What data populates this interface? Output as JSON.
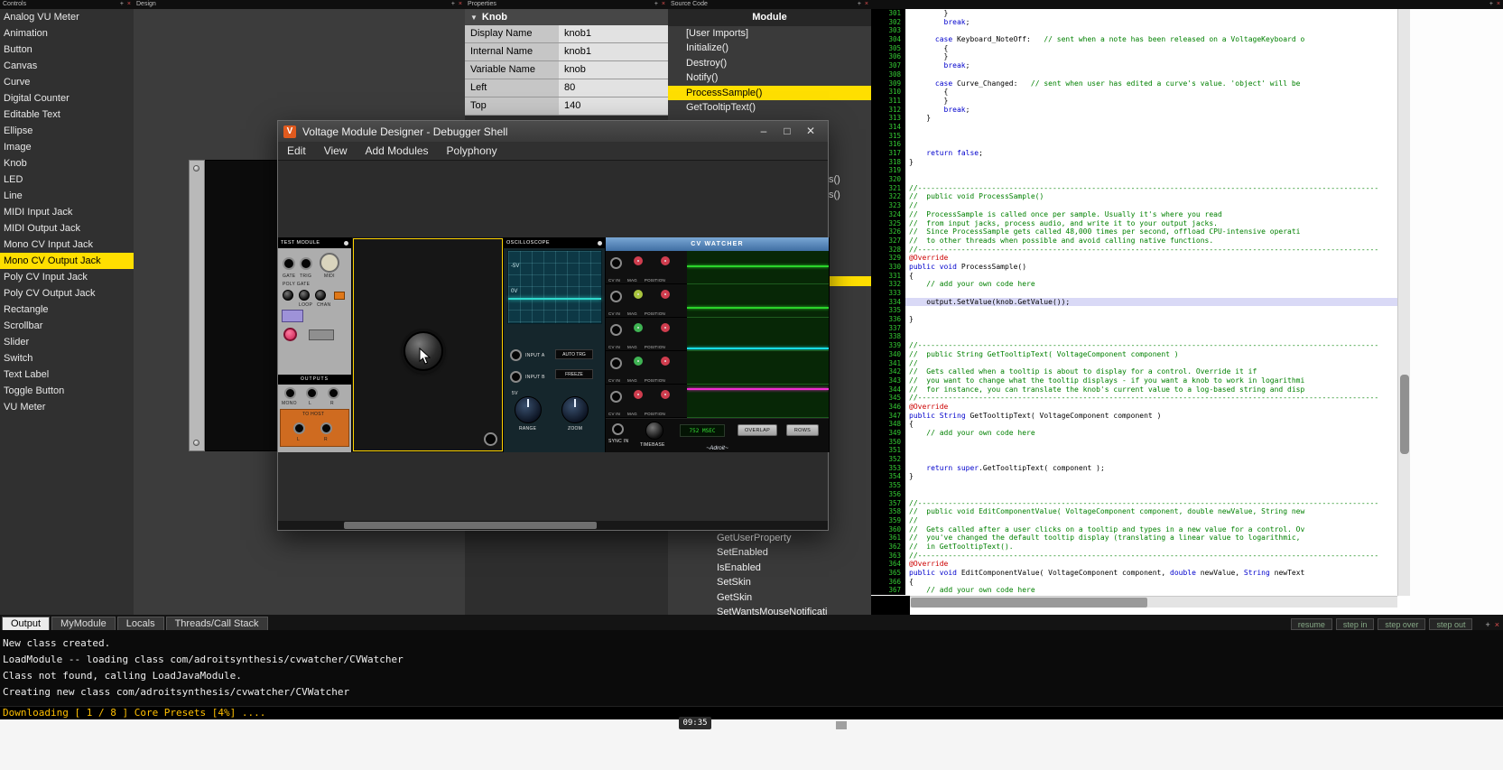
{
  "colors": {
    "accent_yellow": "#ffdf00",
    "selection_red": "#ff5050",
    "keyword_blue": "#0000cc",
    "comment_green": "#008000",
    "annotation_red": "#cc0000",
    "status_yellow": "#ffbf00"
  },
  "panels": {
    "controls": {
      "title": "Controls",
      "selected": "Mono CV Output Jack",
      "items": [
        "Analog VU Meter",
        "Animation",
        "Button",
        "Canvas",
        "Curve",
        "Digital Counter",
        "Editable Text",
        "Ellipse",
        "Image",
        "Knob",
        "LED",
        "Line",
        "MIDI Input Jack",
        "MIDI Output Jack",
        "Mono CV Input Jack",
        "Mono CV Output Jack",
        "Poly CV Input Jack",
        "Poly CV Output Jack",
        "Rectangle",
        "Scrollbar",
        "Slider",
        "Switch",
        "Text Label",
        "Toggle Button",
        "VU Meter"
      ]
    },
    "design": {
      "title": "Design"
    },
    "properties": {
      "title": "Properties",
      "section": "Knob",
      "rows": [
        {
          "label": "Display Name",
          "value": "knob1"
        },
        {
          "label": "Internal Name",
          "value": "knob1"
        },
        {
          "label": "Variable Name",
          "value": "knob"
        },
        {
          "label": "Left",
          "value": "80"
        },
        {
          "label": "Top",
          "value": "140"
        }
      ]
    },
    "source": {
      "title": "Source Code",
      "header": "Module",
      "selected": "ProcessSample()",
      "top_items": [
        "[User Imports]",
        "Initialize()",
        "Destroy()",
        "Notify()",
        "ProcessSample()",
        "GetTooltipText()"
      ],
      "bottom_items": [
        "GetUserProperty",
        "SetEnabled",
        "IsEnabled",
        "SetSkin",
        "GetSkin",
        "SetWantsMouseNotificati"
      ],
      "edge_fragments": [
        "s()",
        "s()"
      ]
    }
  },
  "window": {
    "title": "Voltage Module Designer - Debugger Shell",
    "icon_letter": "V",
    "menus": [
      "Edit",
      "View",
      "Add Modules",
      "Polyphony"
    ],
    "controls": {
      "minimize": "–",
      "maximize": "□",
      "close": "✕"
    },
    "rack": {
      "test_module": {
        "title": "TEST MODULE",
        "jack_labels": [
          "GATE",
          "TRIG",
          "MIDI"
        ],
        "poly_gate": "POLY GATE",
        "knob_labels": [
          "LOOP",
          "CHAN"
        ],
        "outputs": "OUTPUTS",
        "out_jacks": [
          "MONO",
          "L",
          "R"
        ],
        "to_host": "TO HOST",
        "host_jacks": [
          "L",
          "R"
        ]
      },
      "oscilloscope": {
        "title": "OSCILLOSCOPE",
        "screen_labels": [
          "-5V",
          "0V"
        ],
        "input_a": "INPUT A",
        "auto_trg": "AUTO TRG",
        "input_b": "INPUT B",
        "freeze": "FREEZE",
        "range_value": "5V",
        "range": "RANGE",
        "zoom": "ZOOM"
      },
      "cv_watcher": {
        "title": "CV WATCHER",
        "col_labels": [
          "CV IN",
          "MAG",
          "POSITION"
        ],
        "rows": [
          {
            "mag": "#cf3d4e",
            "pos": "#cf3d4e",
            "trace": "#2bd42b",
            "trace_y": 0.45
          },
          {
            "mag": "#a9c43e",
            "pos": "#cf3d4e",
            "trace": "#2bd42b",
            "trace_y": 0.72
          },
          {
            "mag": "#3fb353",
            "pos": "#cf3d4e",
            "trace": "#17dce4",
            "trace_y": 0.94
          },
          {
            "mag": "#3fb353",
            "pos": "#cf3d4e",
            "trace": "",
            "trace_y": 0
          },
          {
            "mag": "#cf3d4e",
            "pos": "#cf3d4e",
            "trace": "#ef2fd0",
            "trace_y": 0.1
          }
        ],
        "sync_in": "SYNC IN",
        "timebase": "TIMEBASE",
        "time_display": "752 MSEC",
        "overlap": "OVERLAP",
        "rows_btn": "ROWS",
        "brand": "~Adroit~"
      }
    }
  },
  "editor": {
    "highlight_line": 334,
    "lines": [
      {
        "n": 301,
        "s": [
          [
            "        }"
          ]
        ]
      },
      {
        "n": 302,
        "s": [
          [
            "        "
          ],
          [
            "break",
            "k"
          ],
          [
            ";"
          ]
        ]
      },
      {
        "n": 303,
        "s": []
      },
      {
        "n": 304,
        "s": [
          [
            "      "
          ],
          [
            "case",
            "k"
          ],
          [
            " Keyboard_NoteOff:   "
          ],
          [
            "// sent when a note has been released on a VoltageKeyboard o",
            "c"
          ]
        ]
      },
      {
        "n": 305,
        "s": [
          [
            "        {"
          ]
        ]
      },
      {
        "n": 306,
        "s": [
          [
            "        }"
          ]
        ]
      },
      {
        "n": 307,
        "s": [
          [
            "        "
          ],
          [
            "break",
            "k"
          ],
          [
            ";"
          ]
        ]
      },
      {
        "n": 308,
        "s": []
      },
      {
        "n": 309,
        "s": [
          [
            "      "
          ],
          [
            "case",
            "k"
          ],
          [
            " Curve_Changed:   "
          ],
          [
            "// sent when user has edited a curve's value. 'object' will be",
            "c"
          ]
        ]
      },
      {
        "n": 310,
        "s": [
          [
            "        {"
          ]
        ]
      },
      {
        "n": 311,
        "s": [
          [
            "        }"
          ]
        ]
      },
      {
        "n": 312,
        "s": [
          [
            "        "
          ],
          [
            "break",
            "k"
          ],
          [
            ";"
          ]
        ]
      },
      {
        "n": 313,
        "s": [
          [
            "    }"
          ]
        ]
      },
      {
        "n": 314,
        "s": []
      },
      {
        "n": 315,
        "s": []
      },
      {
        "n": 316,
        "s": []
      },
      {
        "n": 317,
        "s": [
          [
            "    "
          ],
          [
            "return",
            "k"
          ],
          [
            " "
          ],
          [
            "false",
            "k"
          ],
          [
            ";"
          ]
        ]
      },
      {
        "n": 318,
        "s": [
          [
            "}"
          ]
        ]
      },
      {
        "n": 319,
        "s": []
      },
      {
        "n": 320,
        "s": []
      },
      {
        "n": 321,
        "s": [
          [
            "//----------------------------------------------------------------------------------------------------------",
            "c"
          ]
        ]
      },
      {
        "n": 322,
        "s": [
          [
            "//  public void ProcessSample()",
            "c"
          ]
        ]
      },
      {
        "n": 323,
        "s": [
          [
            "//",
            "c"
          ]
        ]
      },
      {
        "n": 324,
        "s": [
          [
            "//  ProcessSample is called once per sample. Usually it's where you read",
            "c"
          ]
        ]
      },
      {
        "n": 325,
        "s": [
          [
            "//  from input jacks, process audio, and write it to your output jacks.",
            "c"
          ]
        ]
      },
      {
        "n": 326,
        "s": [
          [
            "//  Since ProcessSample gets called 48,000 times per second, offload CPU-intensive operati",
            "c"
          ]
        ]
      },
      {
        "n": 327,
        "s": [
          [
            "//  to other threads when possible and avoid calling native functions.",
            "c"
          ]
        ]
      },
      {
        "n": 328,
        "s": [
          [
            "//----------------------------------------------------------------------------------------------------------",
            "c"
          ]
        ]
      },
      {
        "n": 329,
        "s": [
          [
            "@Override",
            "a"
          ]
        ]
      },
      {
        "n": 330,
        "s": [
          [
            "public",
            "k"
          ],
          [
            " "
          ],
          [
            "void",
            "k"
          ],
          [
            " ProcessSample()"
          ]
        ]
      },
      {
        "n": 331,
        "s": [
          [
            "{"
          ]
        ]
      },
      {
        "n": 332,
        "s": [
          [
            "    "
          ],
          [
            "// add your own code here",
            "c"
          ]
        ]
      },
      {
        "n": 333,
        "s": []
      },
      {
        "n": 334,
        "s": [
          [
            "    output.SetValue(knob.GetValue());"
          ]
        ]
      },
      {
        "n": 335,
        "s": []
      },
      {
        "n": 336,
        "s": [
          [
            "}"
          ]
        ]
      },
      {
        "n": 337,
        "s": []
      },
      {
        "n": 338,
        "s": []
      },
      {
        "n": 339,
        "s": [
          [
            "//----------------------------------------------------------------------------------------------------------",
            "c"
          ]
        ]
      },
      {
        "n": 340,
        "s": [
          [
            "//  public String GetTooltipText( VoltageComponent component )",
            "c"
          ]
        ]
      },
      {
        "n": 341,
        "s": [
          [
            "//",
            "c"
          ]
        ]
      },
      {
        "n": 342,
        "s": [
          [
            "//  Gets called when a tooltip is about to display for a control. Override it if",
            "c"
          ]
        ]
      },
      {
        "n": 343,
        "s": [
          [
            "//  you want to change what the tooltip displays - if you want a knob to work in logarithmi",
            "c"
          ]
        ]
      },
      {
        "n": 344,
        "s": [
          [
            "//  for instance, you can translate the knob's current value to a log-based string and disp",
            "c"
          ]
        ]
      },
      {
        "n": 345,
        "s": [
          [
            "//----------------------------------------------------------------------------------------------------------",
            "c"
          ]
        ]
      },
      {
        "n": 346,
        "s": [
          [
            "@Override",
            "a"
          ]
        ]
      },
      {
        "n": 347,
        "s": [
          [
            "public",
            "k"
          ],
          [
            " "
          ],
          [
            "String",
            "k"
          ],
          [
            " GetTooltipText( VoltageComponent component )"
          ]
        ]
      },
      {
        "n": 348,
        "s": [
          [
            "{"
          ]
        ]
      },
      {
        "n": 349,
        "s": [
          [
            "    "
          ],
          [
            "// add your own code here",
            "c"
          ]
        ]
      },
      {
        "n": 350,
        "s": []
      },
      {
        "n": 351,
        "s": []
      },
      {
        "n": 352,
        "s": []
      },
      {
        "n": 353,
        "s": [
          [
            "    "
          ],
          [
            "return",
            "k"
          ],
          [
            " "
          ],
          [
            "super",
            "k"
          ],
          [
            ".GetTooltipText( component );"
          ]
        ]
      },
      {
        "n": 354,
        "s": [
          [
            "}"
          ]
        ]
      },
      {
        "n": 355,
        "s": []
      },
      {
        "n": 356,
        "s": []
      },
      {
        "n": 357,
        "s": [
          [
            "//----------------------------------------------------------------------------------------------------------",
            "c"
          ]
        ]
      },
      {
        "n": 358,
        "s": [
          [
            "//  public void EditComponentValue( VoltageComponent component, double newValue, String new",
            "c"
          ]
        ]
      },
      {
        "n": 359,
        "s": [
          [
            "//",
            "c"
          ]
        ]
      },
      {
        "n": 360,
        "s": [
          [
            "//  Gets called after a user clicks on a tooltip and types in a new value for a control. Ov",
            "c"
          ]
        ]
      },
      {
        "n": 361,
        "s": [
          [
            "//  you've changed the default tooltip display (translating a linear value to logarithmic,",
            "c"
          ]
        ]
      },
      {
        "n": 362,
        "s": [
          [
            "//  in GetTooltipText().",
            "c"
          ]
        ]
      },
      {
        "n": 363,
        "s": [
          [
            "//----------------------------------------------------------------------------------------------------------",
            "c"
          ]
        ]
      },
      {
        "n": 364,
        "s": [
          [
            "@Override",
            "a"
          ]
        ]
      },
      {
        "n": 365,
        "s": [
          [
            "public",
            "k"
          ],
          [
            " "
          ],
          [
            "void",
            "k"
          ],
          [
            " EditComponentValue( VoltageComponent component, "
          ],
          [
            "double",
            "k"
          ],
          [
            " newValue, "
          ],
          [
            "String",
            "k"
          ],
          [
            " newText"
          ]
        ]
      },
      {
        "n": 366,
        "s": [
          [
            "{"
          ]
        ]
      },
      {
        "n": 367,
        "s": [
          [
            "    "
          ],
          [
            "// add your own code here",
            "c"
          ]
        ]
      }
    ]
  },
  "bottom": {
    "tabs": [
      "Output",
      "MyModule",
      "Locals",
      "Threads/Call Stack"
    ],
    "active_tab": "Output",
    "debug_buttons": [
      "resume",
      "step in",
      "step over",
      "step out"
    ],
    "console": [
      "New class created.",
      "LoadModule -- loading class com/adroitsynthesis/cvwatcher/CVWatcher",
      "Class not found, calling LoadJavaModule.",
      "Creating new class com/adroitsynthesis/cvwatcher/CVWatcher"
    ],
    "status": "Downloading [ 1 / 8 ] Core Presets [4%] ....",
    "clock": "09:35"
  }
}
